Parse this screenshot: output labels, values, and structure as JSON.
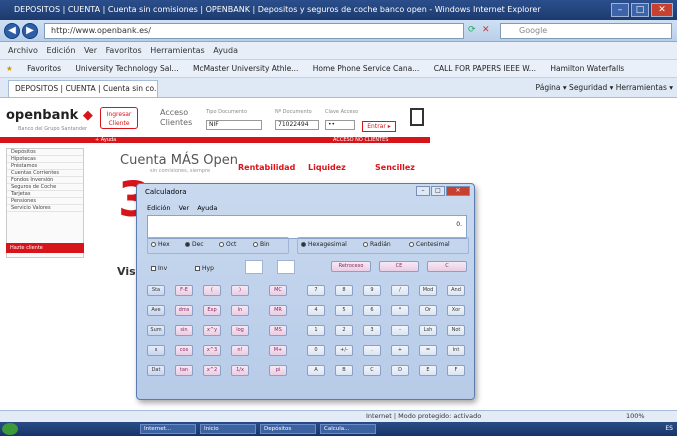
{
  "window": {
    "title": "DEPOSITOS | CUENTA | Cuenta sin comisiones | OPENBANK | Depositos y seguros de coche banco open - Windows Internet Explorer",
    "btn_min": "–",
    "btn_max": "□",
    "btn_close": "✕"
  },
  "addressbar": {
    "url": "http://www.openbank.es/",
    "search_placeholder": "Google"
  },
  "menubar": {
    "items": [
      "Archivo",
      "Edición",
      "Ver",
      "Favoritos",
      "Herramientas",
      "Ayuda"
    ]
  },
  "favorites": {
    "items": [
      "Favoritos",
      "University Technology Sal...",
      "McMaster University Athle...",
      "Home Phone Service Cana...",
      "CALL FOR PAPERS IEEE W...",
      "Hamilton Waterfalls"
    ]
  },
  "tab": {
    "label": "DEPOSITOS | CUENTA | Cuenta sin co...",
    "commands": "Página ▾  Seguridad ▾  Herramientas ▾"
  },
  "page": {
    "logo_a": "openbank",
    "logo_sub": "Banco del Grupo Santander",
    "ingresar": "Ingresar Cliente",
    "acceso_line1": "Acceso",
    "acceso_line2": "Clientes",
    "field1_label": "Tipo Documento",
    "field1_value": "NIF",
    "field2_label": "Nº Documento",
    "field2_value": "71022494",
    "field3_label": "Clave Acceso",
    "field3_value": "••",
    "entrar": "Entrar ▸",
    "redbar_left": "+ Ayuda",
    "redbar_right": "ACCESO NO CLIENTES",
    "side_items": [
      "Depósitos",
      "Hipotecas",
      "Préstamos",
      "Cuentas Corrientes",
      "Fondos Inversión",
      "Seguros de Coche",
      "Tarjetas",
      "Pensiones",
      "Servicio Valores"
    ],
    "side_red": "Hazte cliente",
    "cuenta_title": "Cuenta MÁS Open",
    "cuenta_sub": "sin comisiones, siempre",
    "feat1": "Rentabilidad",
    "feat2": "Liquidez",
    "feat3": "Sencillez",
    "bignum": "3",
    "visa": "Visa"
  },
  "status": {
    "zone": "Internet | Modo protegido: activado",
    "zoom": "100%"
  },
  "taskbar": {
    "buttons": [
      "Internet...",
      "Inicio",
      "Depósitos",
      "Calcula..."
    ],
    "clock": "ES"
  },
  "calculator": {
    "title": "Calculadora",
    "menu": [
      "Edición",
      "Ver",
      "Ayuda"
    ],
    "display": "0.",
    "radios_a": [
      "Hex",
      "Dec",
      "Oct",
      "Bin"
    ],
    "radios_b": [
      "Hexagesimal",
      "Radián",
      "Centesimal"
    ],
    "chk_inv": "Inv",
    "chk_hyp": "Hyp",
    "btn_backspace": "Retroceso",
    "btn_ce": "CE",
    "btn_c": "C",
    "keys": [
      [
        "Sta",
        "F-E",
        "(",
        ")",
        "MC",
        "7",
        "8",
        "9",
        "/",
        "Mod",
        "And"
      ],
      [
        "Ave",
        "dms",
        "Exp",
        "ln",
        "MR",
        "4",
        "5",
        "6",
        "*",
        "Or",
        "Xor"
      ],
      [
        "Sum",
        "sin",
        "x^y",
        "log",
        "MS",
        "1",
        "2",
        "3",
        "-",
        "Lsh",
        "Not"
      ],
      [
        "s",
        "cos",
        "x^3",
        "n!",
        "M+",
        "0",
        "+/-",
        ".",
        "+",
        "=",
        "Int"
      ],
      [
        "Dat",
        "tan",
        "x^2",
        "1/x",
        "pi",
        "A",
        "B",
        "C",
        "D",
        "E",
        "F"
      ]
    ]
  }
}
